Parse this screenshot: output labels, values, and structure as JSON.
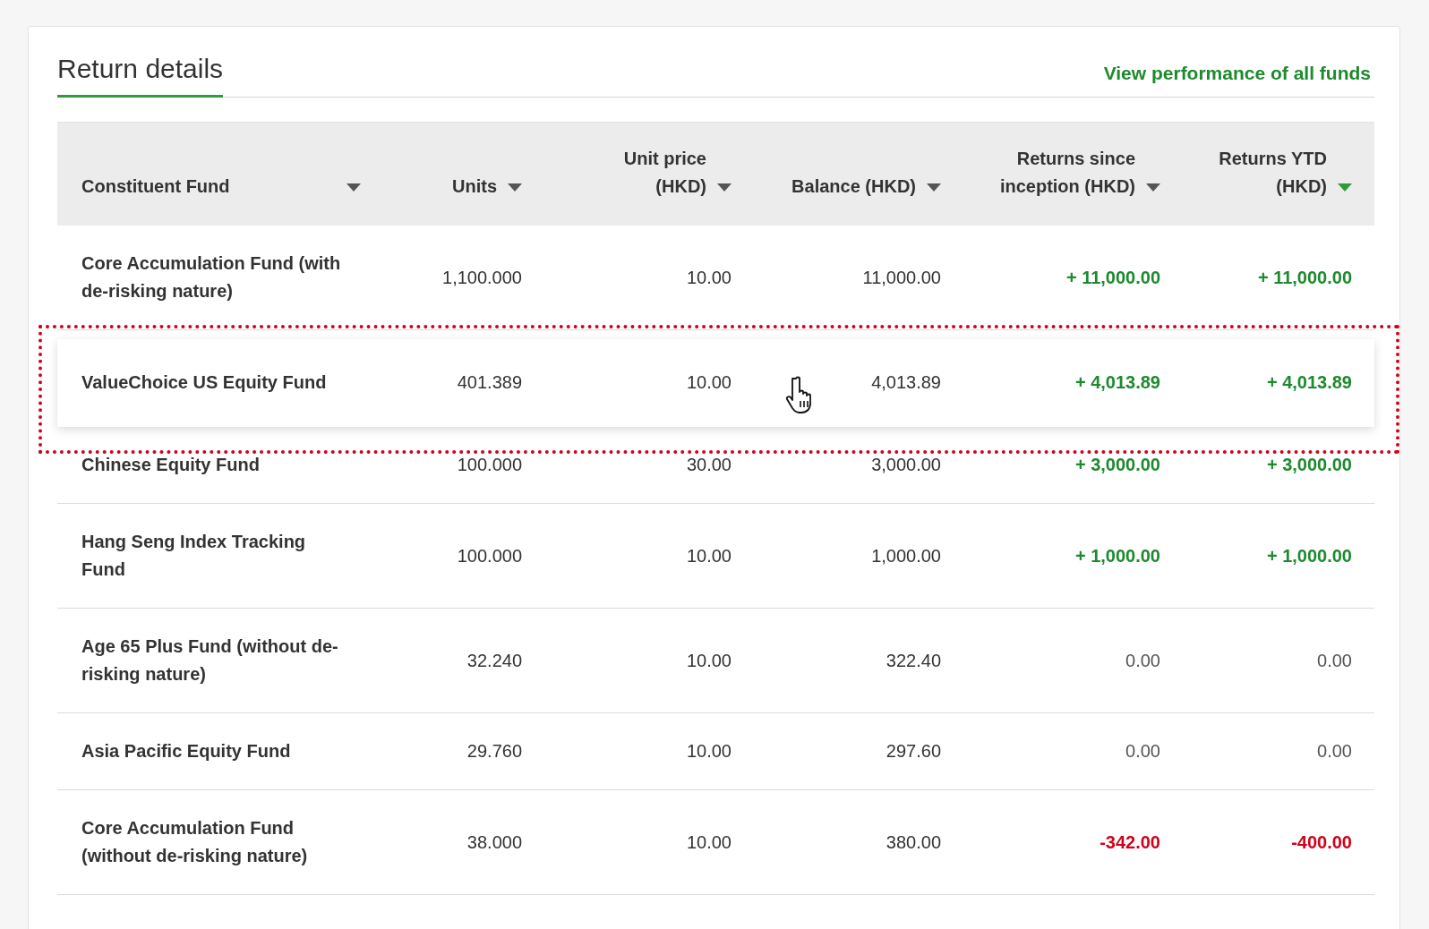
{
  "card": {
    "tab": {
      "label": "Return details",
      "selected": true
    },
    "link": "View performance of all funds"
  },
  "table": {
    "columns": [
      {
        "label": "Constituent Fund",
        "selected": false
      },
      {
        "label": "Units",
        "selected": false
      },
      {
        "label": "Unit price (HKD)",
        "selected": false
      },
      {
        "label": "Balance (HKD)",
        "selected": false
      },
      {
        "label": "Returns since inception (HKD)",
        "selected": false
      },
      {
        "label": "Returns YTD (HKD)",
        "selected": true
      }
    ],
    "rows": [
      {
        "fund": "Core Accumulation Fund (with de-risking nature)",
        "units": "1,100.000",
        "unit_price": "10.00",
        "balance": "11,000.00",
        "returns_since_inception": "+ 11,000.00",
        "returns_ytd": "+ 11,000.00",
        "color": "#1d8a2e",
        "highlighted": false
      },
      {
        "fund": "ValueChoice US Equity Fund",
        "units": "401.389",
        "unit_price": "10.00",
        "balance": "4,013.89",
        "returns_since_inception": "+ 4,013.89",
        "returns_ytd": "+ 4,013.89",
        "color": "#1d8a2e",
        "highlighted": true
      },
      {
        "fund": "Chinese Equity Fund",
        "units": "100.000",
        "unit_price": "30.00",
        "balance": "3,000.00",
        "returns_since_inception": "+ 3,000.00",
        "returns_ytd": "+ 3,000.00",
        "color": "#1d8a2e",
        "highlighted": false
      },
      {
        "fund": "Hang Seng Index Tracking Fund",
        "units": "100.000",
        "unit_price": "10.00",
        "balance": "1,000.00",
        "returns_since_inception": "+ 1,000.00",
        "returns_ytd": "+ 1,000.00",
        "color": "#1d8a2e",
        "highlighted": false
      },
      {
        "fund": "Age 65 Plus Fund (without de-risking nature)",
        "units": "32.240",
        "unit_price": "10.00",
        "balance": "322.40",
        "returns_since_inception": "0.00",
        "returns_ytd": "0.00",
        "color": "#555555",
        "highlighted": false
      },
      {
        "fund": "Asia Pacific Equity Fund",
        "units": "29.760",
        "unit_price": "10.00",
        "balance": "297.60",
        "returns_since_inception": "0.00",
        "returns_ytd": "0.00",
        "color": "#555555",
        "highlighted": false
      },
      {
        "fund": "Core Accumulation Fund (without de-risking nature)",
        "units": "38.000",
        "unit_price": "10.00",
        "balance": "380.00",
        "returns_since_inception": "-342.00",
        "returns_ytd": "-400.00",
        "color": "#d0021b",
        "highlighted": false
      }
    ]
  }
}
